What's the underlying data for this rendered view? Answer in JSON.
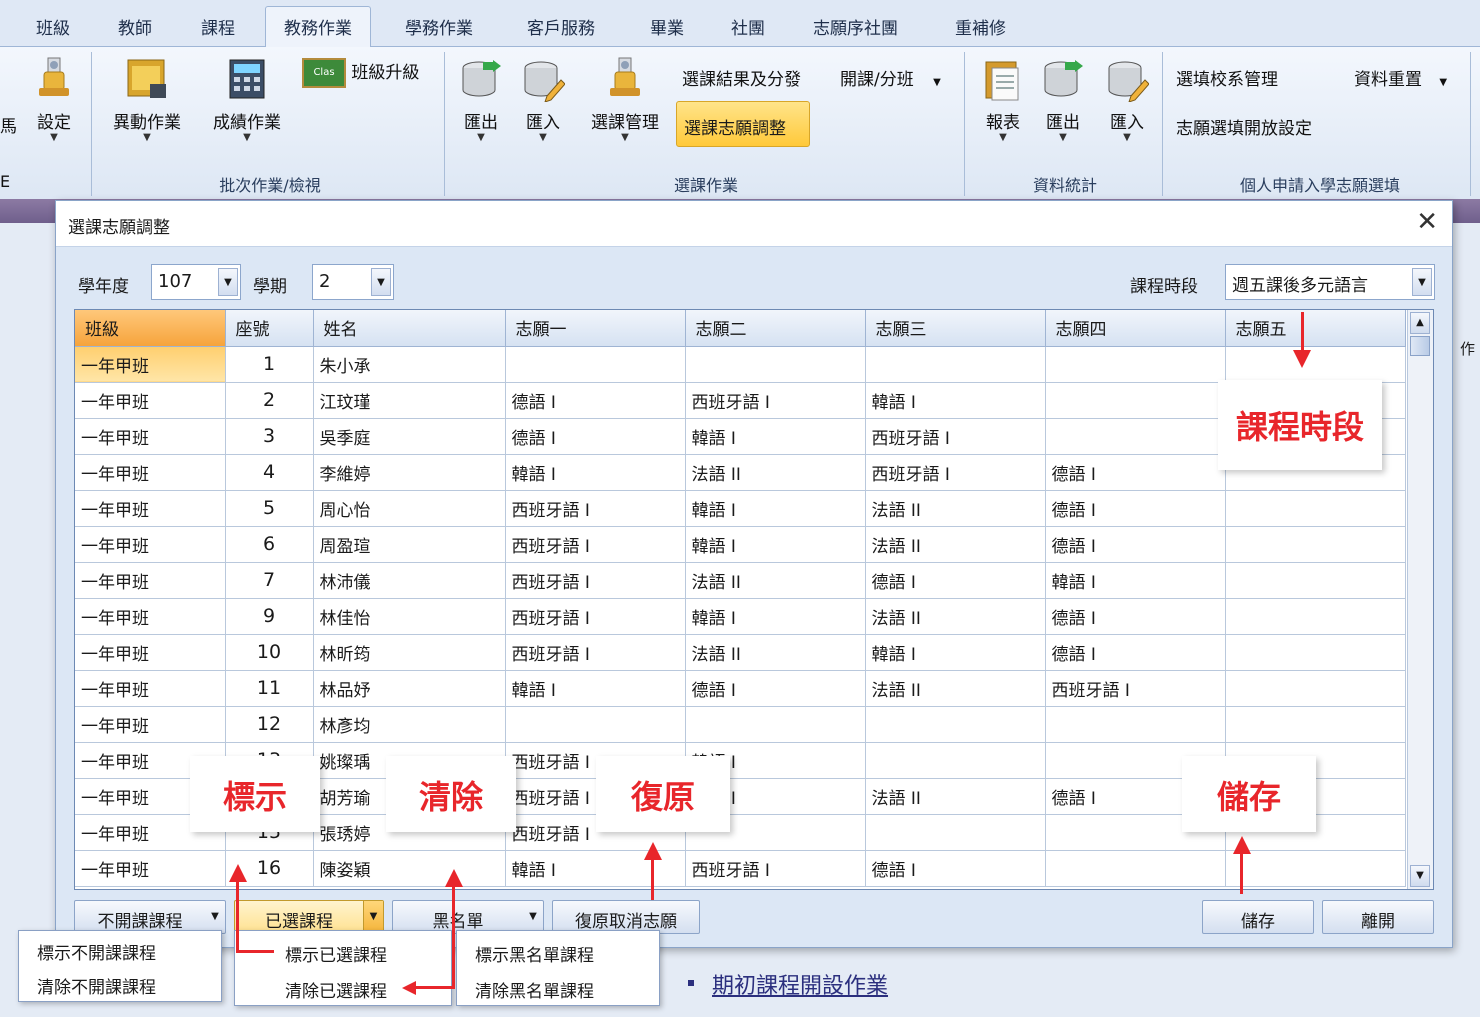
{
  "ribbon_tabs": [
    "班級",
    "教師",
    "課程",
    "教務作業",
    "學務作業",
    "客戶服務",
    "畢業",
    "社團",
    "志願序社團",
    "重補修"
  ],
  "active_tab": "教務作業",
  "ribbon": {
    "edge_left_text": "馬",
    "edge_left_group_text": "E",
    "setting": "設定",
    "change": "異動作業",
    "grade": "成績作業",
    "class_promote": "班級升級",
    "group_batch": "批次作業/檢視",
    "export1": "匯出",
    "import1": "匯入",
    "course_manage": "選課管理",
    "result_assign": "選課結果及分發",
    "open_class": "開課/分班",
    "wish_adjust": "選課志願調整",
    "group_course": "選課作業",
    "report": "報表",
    "export2": "匯出",
    "import2": "匯入",
    "group_stats": "資料統計",
    "school_manage": "選填校系管理",
    "data_reset": "資料重置",
    "wish_open": "志願選填開放設定",
    "group_personal": "個人申請入學志願選填",
    "icon_class_text": "Clas"
  },
  "dialog": {
    "title": "選課志願調整",
    "year_label": "學年度",
    "year_value": "107",
    "term_label": "學期",
    "term_value": "2",
    "period_label": "課程時段",
    "period_value": "週五課後多元語言",
    "side_text": "作"
  },
  "grid": {
    "columns": [
      "班級",
      "座號",
      "姓名",
      "志願一",
      "志願二",
      "志願三",
      "志願四",
      "志願五"
    ],
    "rows": [
      [
        "一年甲班",
        "1",
        "朱小承",
        "",
        "",
        "",
        "",
        ""
      ],
      [
        "一年甲班",
        "2",
        "江玟瑾",
        "德語 I",
        "西班牙語 I",
        "韓語 I",
        "",
        ""
      ],
      [
        "一年甲班",
        "3",
        "吳季庭",
        "德語 I",
        "韓語 I",
        "西班牙語 I",
        "",
        ""
      ],
      [
        "一年甲班",
        "4",
        "李維婷",
        "韓語 I",
        "法語 II",
        "西班牙語 I",
        "德語 I",
        ""
      ],
      [
        "一年甲班",
        "5",
        "周心怡",
        "西班牙語 I",
        "韓語 I",
        "法語 II",
        "德語 I",
        ""
      ],
      [
        "一年甲班",
        "6",
        "周盈瑄",
        "西班牙語 I",
        "韓語 I",
        "法語 II",
        "德語 I",
        ""
      ],
      [
        "一年甲班",
        "7",
        "林沛儀",
        "西班牙語 I",
        "法語 II",
        "德語 I",
        "韓語 I",
        ""
      ],
      [
        "一年甲班",
        "9",
        "林佳怡",
        "西班牙語 I",
        "韓語 I",
        "法語 II",
        "德語 I",
        ""
      ],
      [
        "一年甲班",
        "10",
        "林昕筠",
        "西班牙語 I",
        "法語 II",
        "韓語 I",
        "德語 I",
        ""
      ],
      [
        "一年甲班",
        "11",
        "林品妤",
        "韓語 I",
        "德語 I",
        "法語 II",
        "西班牙語 I",
        ""
      ],
      [
        "一年甲班",
        "12",
        "林彥均",
        "",
        "",
        "",
        "",
        ""
      ],
      [
        "一年甲班",
        "13",
        "姚璨瑀",
        "西班牙語 I",
        "韓語 I",
        "",
        "",
        ""
      ],
      [
        "一年甲班",
        "14",
        "胡芳瑜",
        "西班牙語 I",
        "德語 I",
        "法語 II",
        "德語 I",
        ""
      ],
      [
        "一年甲班",
        "15",
        "張琇婷",
        "西班牙語 I",
        "",
        "",
        "",
        ""
      ],
      [
        "一年甲班",
        "16",
        "陳姿穎",
        "韓語 I",
        "西班牙語 I",
        "德語 I",
        "",
        ""
      ]
    ]
  },
  "buttons": {
    "no_open": "不開課課程",
    "selected": "已選課程",
    "blacklist": "黑名單",
    "restore": "復原取消志願",
    "save": "儲存",
    "leave": "離開"
  },
  "menus": {
    "no_open": [
      "標示不開課課程",
      "清除不開課課程"
    ],
    "selected": [
      "標示已選課程",
      "清除已選課程"
    ],
    "blacklist": [
      "標示黑名單課程",
      "清除黑名單課程"
    ]
  },
  "annotations": {
    "period": "課程時段",
    "mark": "標示",
    "clear": "清除",
    "restore": "復原",
    "save": "儲存"
  },
  "background": {
    "link": "期初課程開設作業"
  },
  "colors": {
    "annotation_red": "#e8262b",
    "highlight_orange": "#ffc93a"
  }
}
